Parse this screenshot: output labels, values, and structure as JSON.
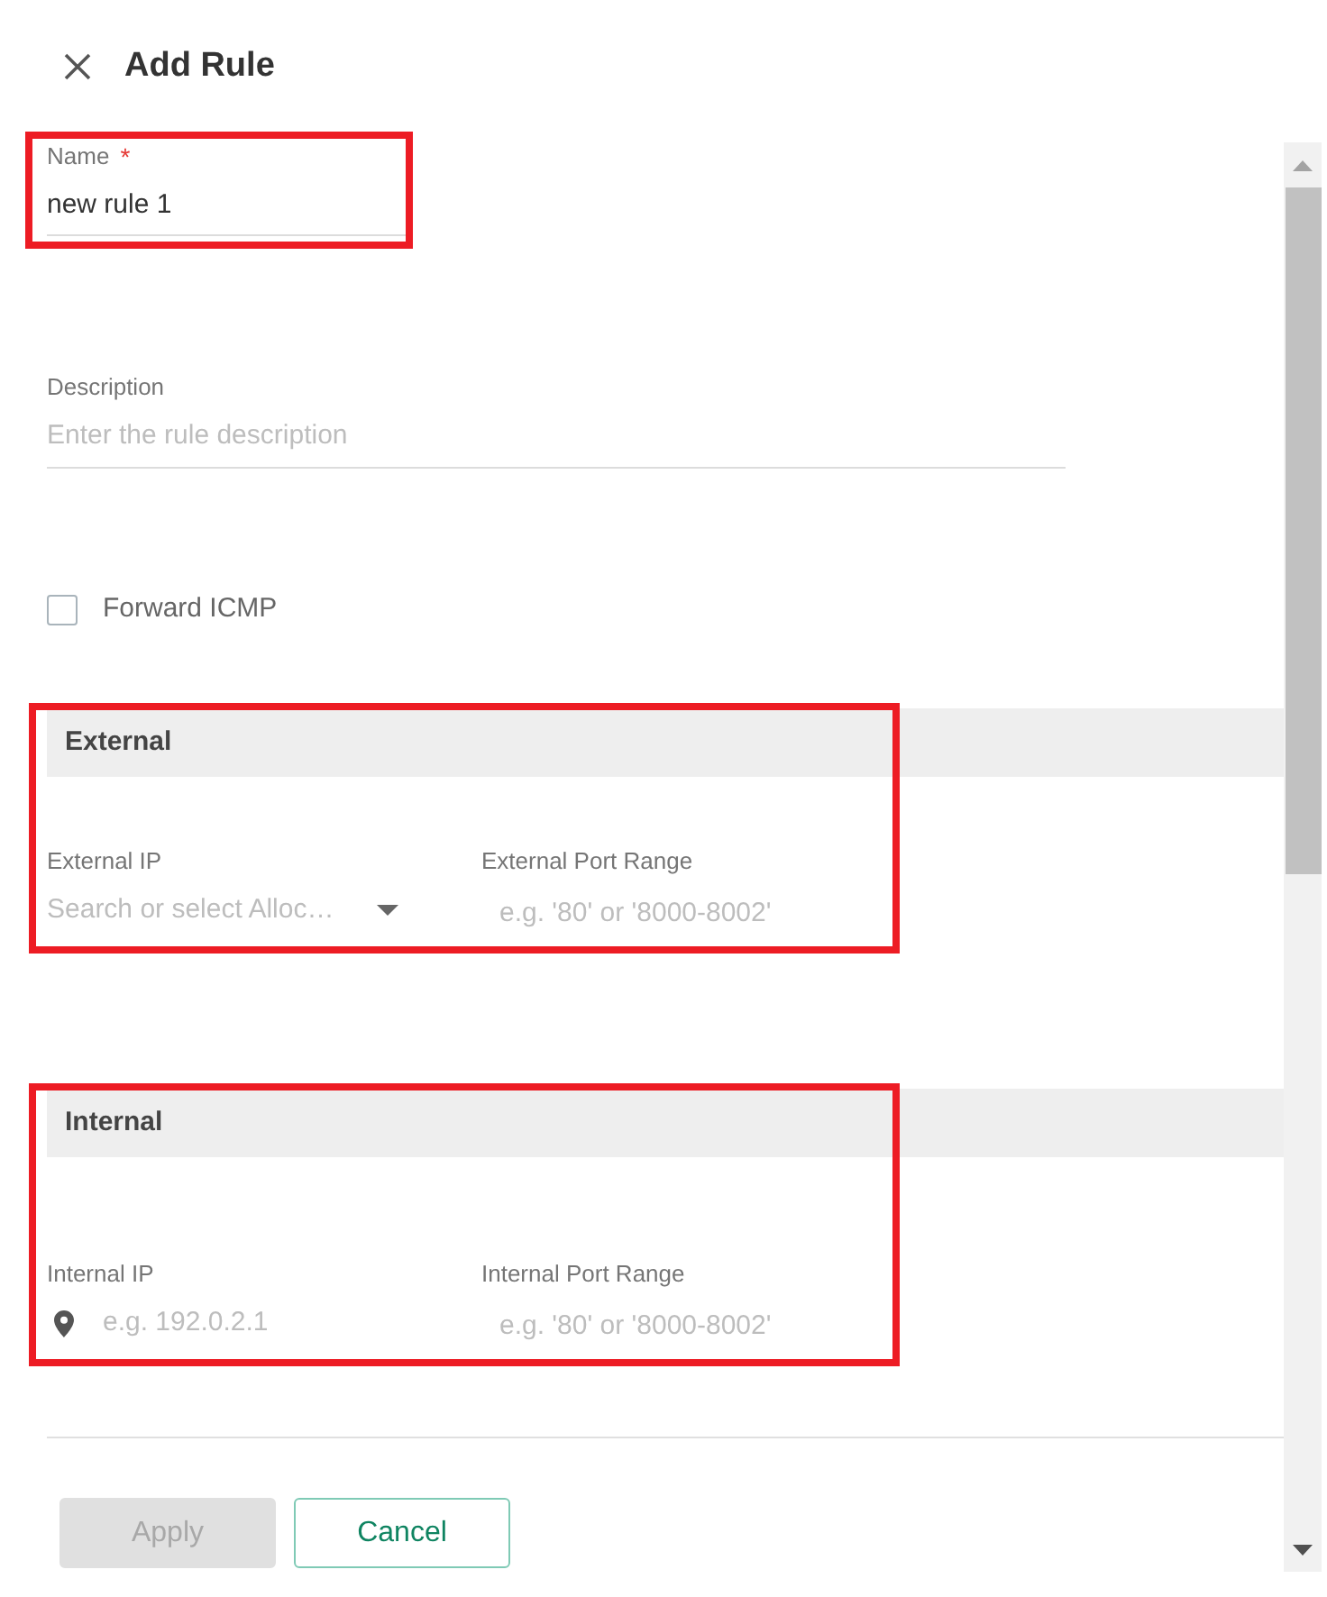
{
  "header": {
    "title": "Add Rule"
  },
  "form": {
    "name": {
      "label": "Name",
      "required_mark": "*",
      "value": "new rule 1",
      "highlighted": true
    },
    "description": {
      "label": "Description",
      "placeholder": "Enter the rule description"
    },
    "forward_icmp": {
      "label": "Forward ICMP",
      "checked": false
    }
  },
  "sections": [
    {
      "title": "External",
      "highlighted": true,
      "fields": [
        {
          "kind": "select",
          "label": "External IP",
          "placeholder": "Search or select Alloc…"
        },
        {
          "kind": "text",
          "label": "External Port Range",
          "placeholder": "e.g. '80' or '8000-8002'"
        }
      ]
    },
    {
      "title": "Internal",
      "highlighted": true,
      "fields": [
        {
          "kind": "ip",
          "label": "Internal IP",
          "placeholder": "e.g. 192.0.2.1"
        },
        {
          "kind": "text",
          "label": "Internal Port Range",
          "placeholder": "e.g. '80' or '8000-8002'"
        }
      ]
    }
  ],
  "buttons": [
    {
      "label": "Apply",
      "kind": "filled",
      "disabled": true
    },
    {
      "label": "Cancel",
      "kind": "outlined",
      "disabled": false
    }
  ]
}
